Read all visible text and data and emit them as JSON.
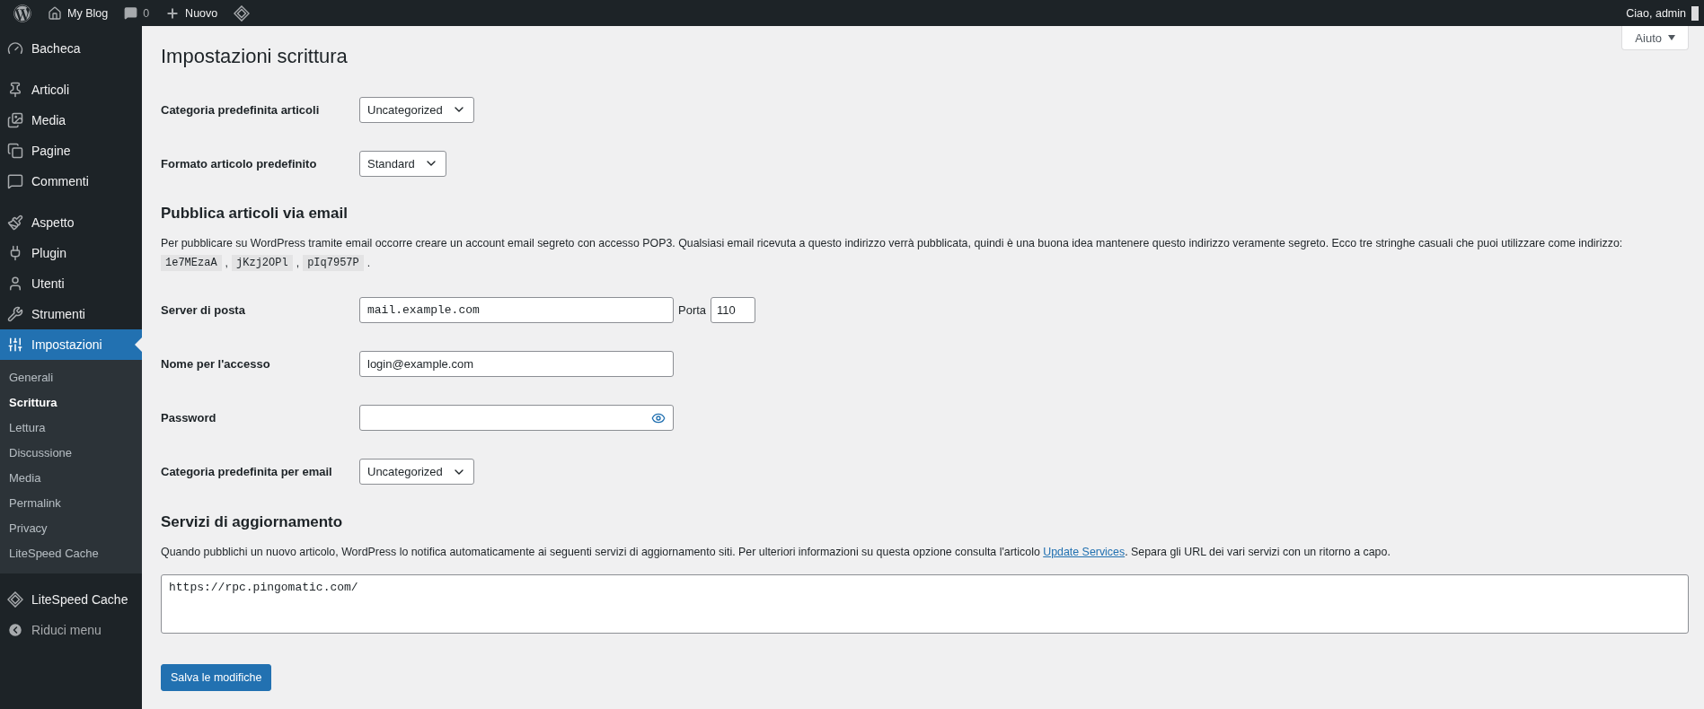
{
  "admin_bar": {
    "items": [
      {
        "kind": "logo"
      },
      {
        "kind": "site",
        "label": "My Blog"
      },
      {
        "kind": "comments",
        "label": "0"
      },
      {
        "kind": "new",
        "label": "Nuovo"
      },
      {
        "kind": "litespeed"
      }
    ],
    "greeting": "Ciao, admin"
  },
  "help_button": "Aiuto",
  "sidebar": {
    "groups": [
      [
        {
          "kind": "dashboard",
          "label": "Bacheca",
          "selected": false
        }
      ],
      [
        {
          "kind": "posts",
          "label": "Articoli",
          "selected": false
        },
        {
          "kind": "media",
          "label": "Media",
          "selected": false
        },
        {
          "kind": "pages",
          "label": "Pagine",
          "selected": false
        },
        {
          "kind": "comments",
          "label": "Commenti",
          "selected": false
        }
      ],
      [
        {
          "kind": "appearance",
          "label": "Aspetto",
          "selected": false
        },
        {
          "kind": "plugins",
          "label": "Plugin",
          "selected": false
        },
        {
          "kind": "users",
          "label": "Utenti",
          "selected": false
        },
        {
          "kind": "tools",
          "label": "Strumenti",
          "selected": false
        },
        {
          "kind": "settings",
          "label": "Impostazioni",
          "selected": true,
          "children": [
            {
              "label": "Generali",
              "selected": false
            },
            {
              "label": "Scrittura",
              "selected": true
            },
            {
              "label": "Lettura",
              "selected": false
            },
            {
              "label": "Discussione",
              "selected": false
            },
            {
              "label": "Media",
              "selected": false
            },
            {
              "label": "Permalink",
              "selected": false
            },
            {
              "label": "Privacy",
              "selected": false
            },
            {
              "label": "LiteSpeed Cache",
              "selected": false
            }
          ]
        }
      ],
      [
        {
          "kind": "litespeed",
          "label": "LiteSpeed Cache",
          "selected": false
        }
      ]
    ],
    "collapse": "Riduci menu"
  },
  "page_title": "Impostazioni scrittura",
  "settings": [
    {
      "kind": "select",
      "label": "Categoria predefinita articoli",
      "value": "Uncategorized"
    },
    {
      "kind": "select",
      "label": "Formato articolo predefinito",
      "value": "Standard"
    },
    {
      "kind": "heading",
      "title": "Pubblica articoli via email"
    },
    {
      "kind": "note",
      "text": "Per pubblicare su WordPress tramite email occorre creare un account email segreto con accesso POP3. Qualsiasi email ricevuta a questo indirizzo verrà pubblicata, quindi è una buona idea mantenere questo indirizzo veramente segreto. Ecco tre stringhe casuali che puoi utilizzare come indirizzo:",
      "parts": [
        {
          "kind": "code",
          "text": "1e7MEzaA"
        },
        {
          "kind": "plain",
          "text": ","
        },
        {
          "kind": "code",
          "text": "jKzj2OPl"
        },
        {
          "kind": "plain",
          "text": ","
        },
        {
          "kind": "code",
          "text": "pIq7957P"
        },
        {
          "kind": "plain",
          "text": "."
        }
      ]
    },
    {
      "kind": "server",
      "label": "Server di posta",
      "value": "mail.example.com",
      "port_label": "Porta",
      "port": "110"
    },
    {
      "kind": "text",
      "label": "Nome per l'accesso",
      "value": "login@example.com"
    },
    {
      "kind": "password",
      "label": "Password"
    },
    {
      "kind": "select",
      "label": "Categoria predefinita per email",
      "value": "Uncategorized"
    },
    {
      "kind": "heading",
      "title": "Servizi di aggiornamento"
    },
    {
      "kind": "link_note",
      "before": "Quando pubblichi un nuovo articolo, WordPress lo notifica automaticamente ai seguenti servizi di aggiornamento siti. Per ulteriori informazioni su questa opzione consulta l'articolo ",
      "link": "Update Services",
      "after": ". Separa gli URL dei vari servizi con un ritorno a capo."
    },
    {
      "kind": "textarea",
      "value": "https://rpc.pingomatic.com/"
    }
  ],
  "save_button": "Salva le modifiche"
}
